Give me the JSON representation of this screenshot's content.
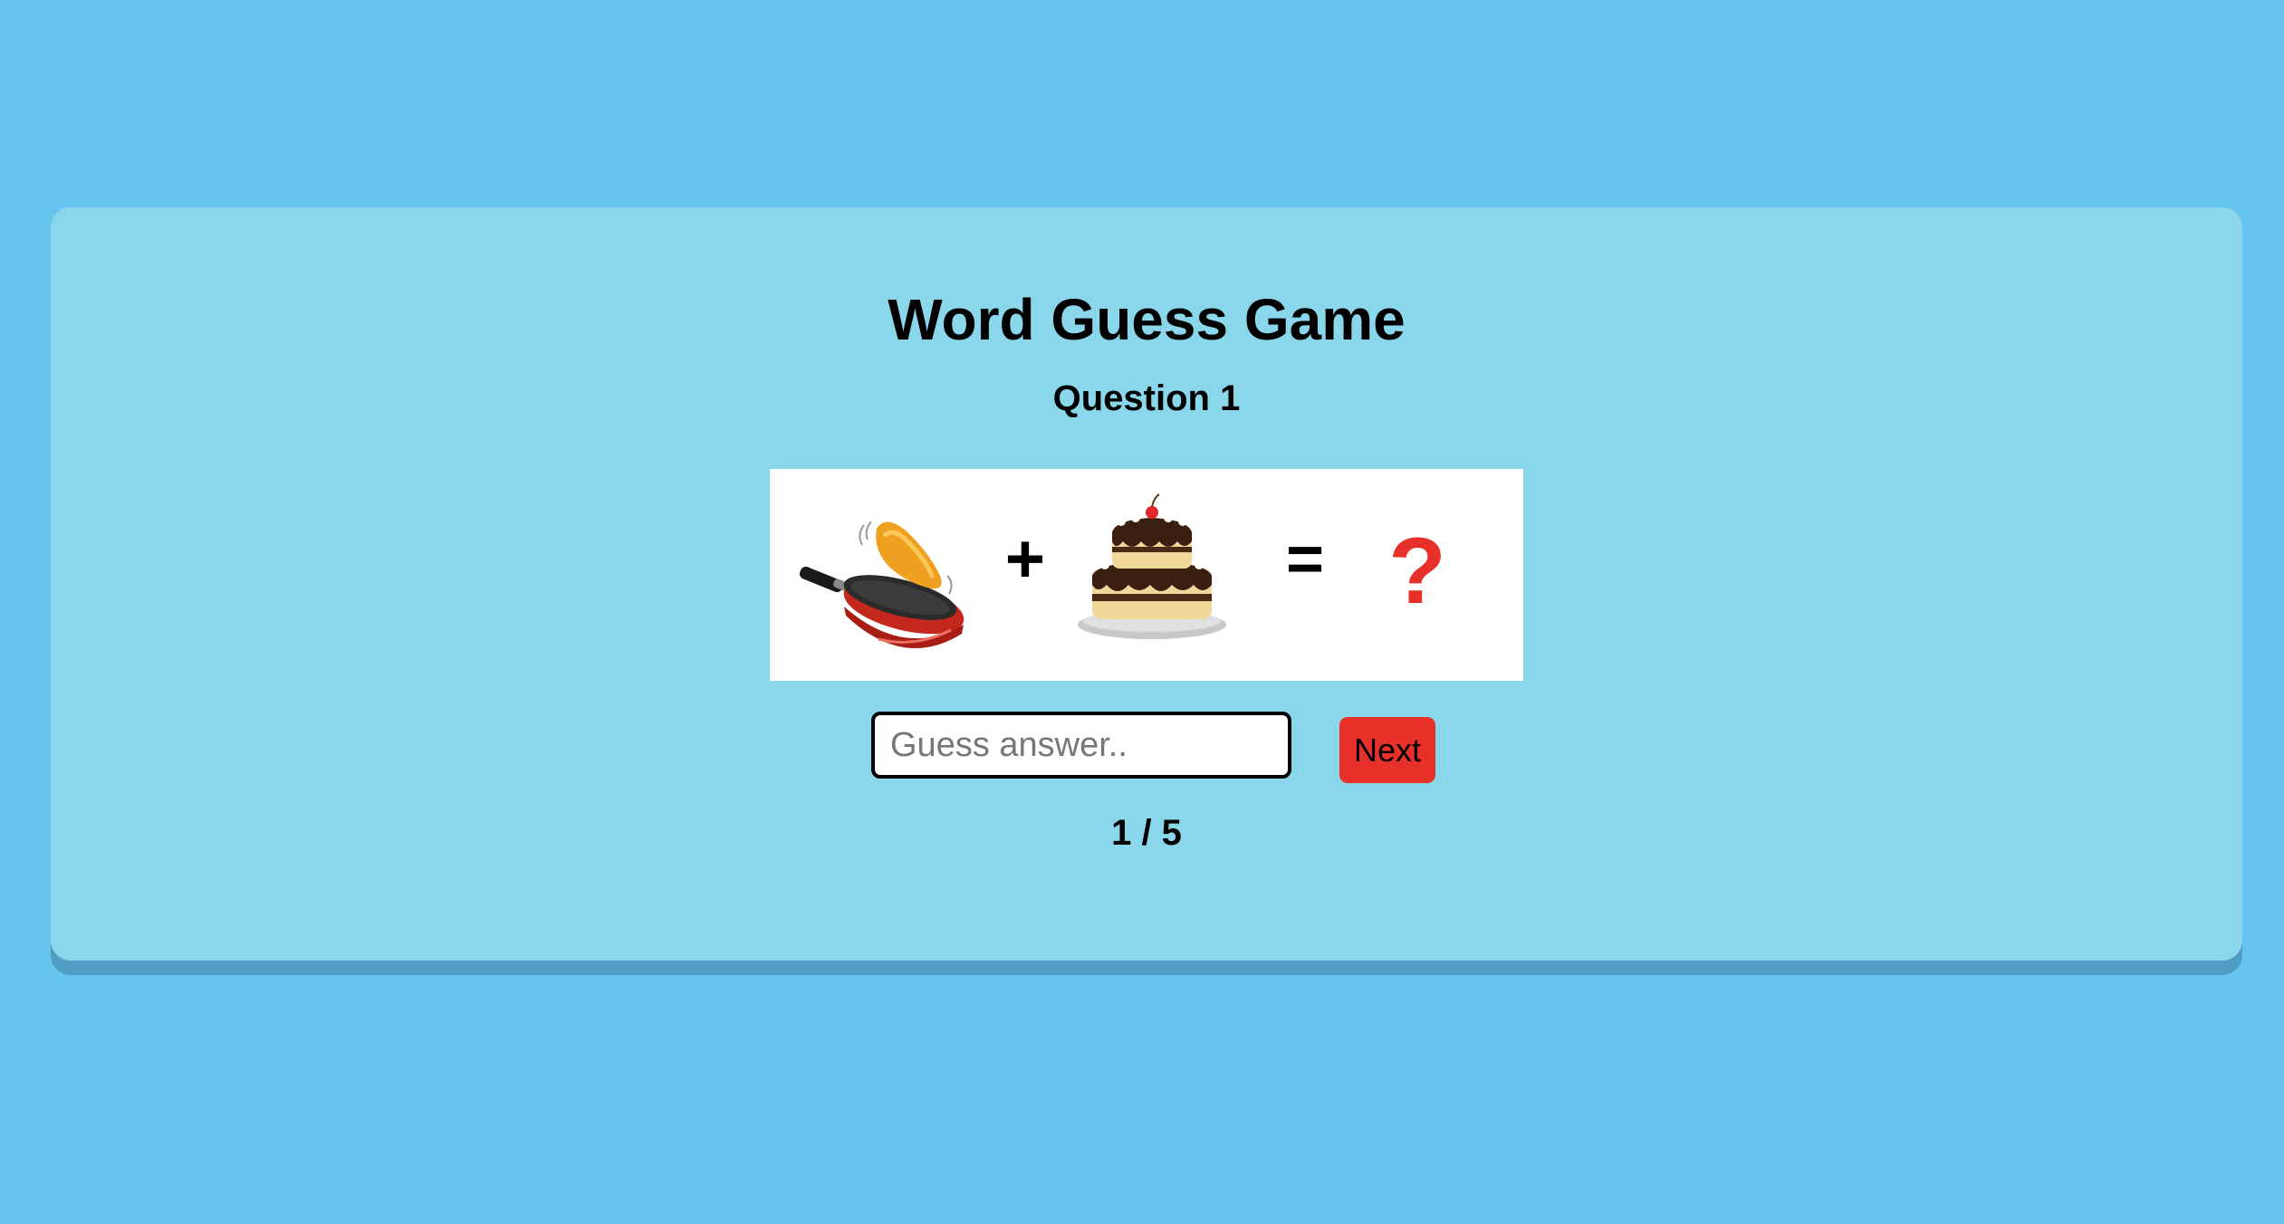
{
  "game": {
    "title": "Word Guess Game",
    "question_label": "Question 1",
    "puzzle": {
      "items": [
        "frying-pan-pancake-image",
        "plus-sign",
        "cake-image",
        "equals-sign",
        "question-mark"
      ],
      "plus_symbol": "+",
      "equals_symbol": "=",
      "unknown_symbol": "?"
    },
    "answer_input": {
      "value": "",
      "placeholder": "Guess answer.."
    },
    "next_label": "Next",
    "progress": "1 / 5"
  },
  "colors": {
    "background": "#65c5ee",
    "card": "#8ad6eb",
    "card_shadow": "#4f9cc4",
    "next_button": "#e8302a",
    "question_mark": "#e8302a"
  }
}
